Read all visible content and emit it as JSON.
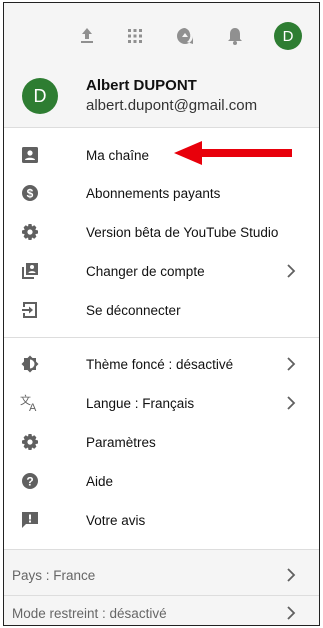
{
  "top_icons": [
    "upload-icon",
    "apps-grid-icon",
    "messages-icon",
    "bell-icon"
  ],
  "avatar_initial": "D",
  "account": {
    "name": "Albert DUPONT",
    "email": "albert.dupont@gmail.com"
  },
  "menu": [
    {
      "label": "Ma chaîne",
      "icon": "person-badge-icon",
      "has_chevron": false
    },
    {
      "label": "Abonnements payants",
      "icon": "dollar-icon",
      "has_chevron": false
    },
    {
      "label": "Version bêta de YouTube Studio",
      "icon": "gear-icon",
      "has_chevron": false
    },
    {
      "label": "Changer de compte",
      "icon": "switch-account-icon",
      "has_chevron": true
    },
    {
      "label": "Se déconnecter",
      "icon": "sign-out-icon",
      "has_chevron": false
    }
  ],
  "settings_menu": [
    {
      "label": "Thème foncé : désactivé",
      "icon": "dark-theme-icon",
      "has_chevron": true
    },
    {
      "label": "Langue : Français",
      "icon": "translate-icon",
      "has_chevron": true
    },
    {
      "label": "Paramètres",
      "icon": "gear-icon",
      "has_chevron": false
    },
    {
      "label": "Aide",
      "icon": "help-icon",
      "has_chevron": false
    },
    {
      "label": "Votre avis",
      "icon": "feedback-icon",
      "has_chevron": false
    }
  ],
  "footer": [
    {
      "label": "Pays : France",
      "has_chevron": true
    },
    {
      "label": "Mode restreint : désactivé",
      "has_chevron": true
    }
  ],
  "colors": {
    "avatar": "#2e7d32",
    "arrow": "#e8000b",
    "icon": "#606060"
  }
}
